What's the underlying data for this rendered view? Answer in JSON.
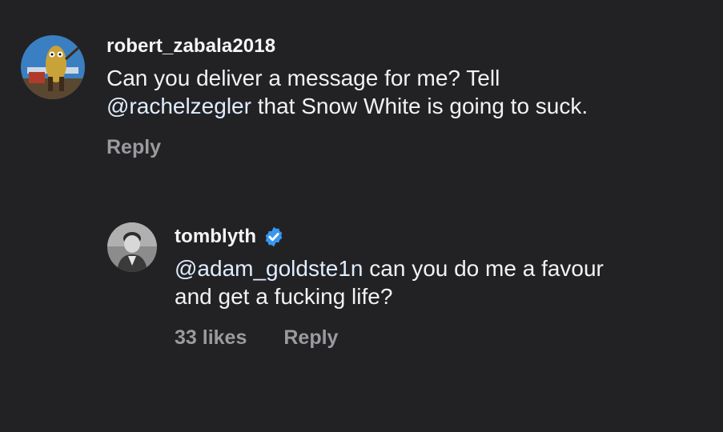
{
  "comment": {
    "username": "robert_zabala2018",
    "text_line1": "Can you deliver a message for me? Tell",
    "mention": "@rachelzegler",
    "text_line2_rest": " that Snow White is going to suck.",
    "reply_label": "Reply"
  },
  "reply": {
    "username": "tomblyth",
    "verified_icon": "verified-badge-icon",
    "mention": "@adam_goldste1n",
    "text_line1_rest": " can you do me a favour",
    "text_line2": "and get a fucking life?",
    "likes": "33 likes",
    "reply_label": "Reply"
  },
  "colors": {
    "background": "#222224",
    "text": "#f2f2f2",
    "meta": "#9a9a9f",
    "verified": "#3897f0"
  }
}
